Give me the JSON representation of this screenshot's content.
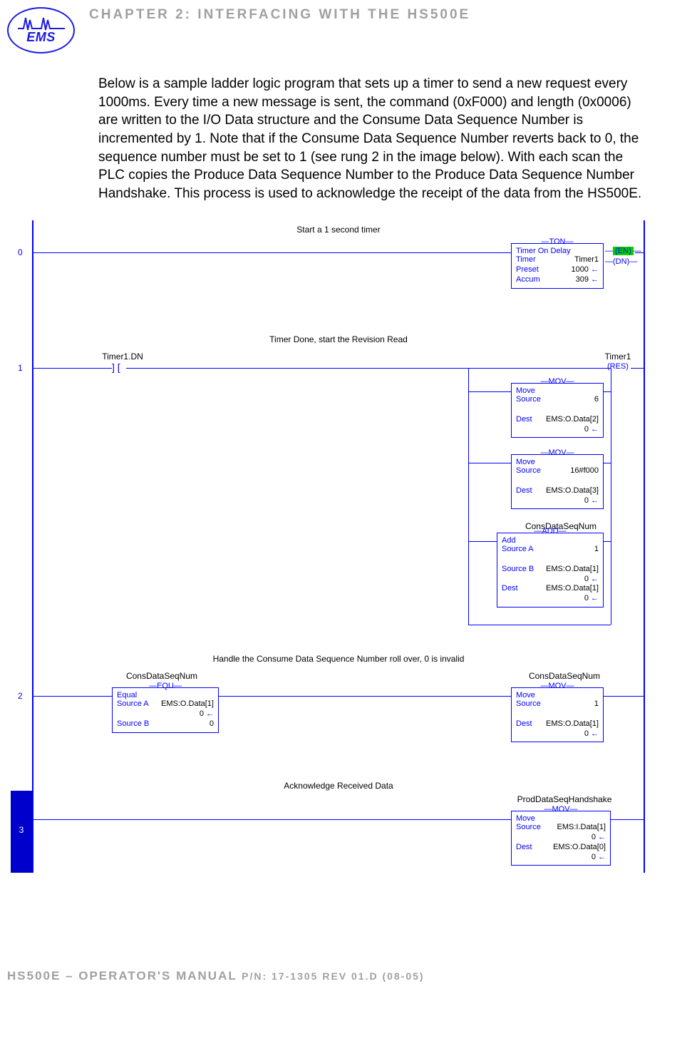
{
  "header": {
    "logo_text": "EMS",
    "chapter": "CHAPTER 2: INTERFACING WITH THE HS500E"
  },
  "body_paragraph": "Below is a sample ladder logic program that sets up a timer to send a new request every 1000ms. Every time a new message is sent, the command (0xF000) and length (0x0006) are written to the I/O Data structure and the Consume Data Sequence Number is incremented by 1. Note that if the Consume Data Sequence Number reverts back to 0, the sequence number must be set to 1 (see rung 2 in the image below). With each scan the PLC copies the Produce Data Sequence Number to the Produce Data Sequence Number Handshake. This process is used to acknowledge the receipt of the data from the HS500E.",
  "ladder": {
    "rung0": {
      "num": "0",
      "comment": "Start a 1 second timer",
      "ton": {
        "type": "TON",
        "title": "Timer On Delay",
        "rows": [
          {
            "l": "Timer",
            "r": "Timer1"
          },
          {
            "l": "Preset",
            "r": "1000"
          },
          {
            "l": "Accum",
            "r": "309"
          }
        ],
        "en": "(EN)",
        "dn": "(DN)"
      }
    },
    "rung1": {
      "num": "1",
      "comment": "Timer Done, start the Revision Read",
      "contact_tag": "Timer1.DN",
      "res_tag": "Timer1",
      "res": "(RES)",
      "mov1": {
        "type": "MOV",
        "title": "Move",
        "rows": [
          {
            "l": "Source",
            "r": "6"
          },
          {
            "l": "",
            "r": ""
          },
          {
            "l": "Dest",
            "r": "EMS:O.Data[2]"
          },
          {
            "l": "",
            "r": "0"
          }
        ]
      },
      "mov2": {
        "type": "MOV",
        "title": "Move",
        "rows": [
          {
            "l": "Source",
            "r": "16#f000"
          },
          {
            "l": "",
            "r": ""
          },
          {
            "l": "Dest",
            "r": "EMS:O.Data[3]"
          },
          {
            "l": "",
            "r": "0"
          }
        ]
      },
      "add": {
        "tag_above": "ConsDataSeqNum",
        "type": "ADD",
        "title": "Add",
        "rows": [
          {
            "l": "Source A",
            "r": "1"
          },
          {
            "l": "",
            "r": ""
          },
          {
            "l": "Source B",
            "r": "EMS:O.Data[1]"
          },
          {
            "l": "",
            "r": "0"
          },
          {
            "l": "Dest",
            "r": "EMS:O.Data[1]"
          },
          {
            "l": "",
            "r": "0"
          }
        ]
      }
    },
    "rung2": {
      "num": "2",
      "comment": "Handle the Consume Data Sequence Number roll over, 0 is invalid",
      "equ": {
        "tag_above": "ConsDataSeqNum",
        "type": "EQU",
        "title": "Equal",
        "rows": [
          {
            "l": "Source A",
            "r": "EMS:O.Data[1]"
          },
          {
            "l": "",
            "r": "0"
          },
          {
            "l": "Source B",
            "r": "0"
          }
        ]
      },
      "mov": {
        "tag_above": "ConsDataSeqNum",
        "type": "MOV",
        "title": "Move",
        "rows": [
          {
            "l": "Source",
            "r": "1"
          },
          {
            "l": "",
            "r": ""
          },
          {
            "l": "Dest",
            "r": "EMS:O.Data[1]"
          },
          {
            "l": "",
            "r": "0"
          }
        ]
      }
    },
    "rung3": {
      "num": "3",
      "comment": "Acknowledge Received Data",
      "mov": {
        "tag_above": "ProdDataSeqHandshake",
        "type": "MOV",
        "title": "Move",
        "rows": [
          {
            "l": "Source",
            "r": "EMS:I.Data[1]"
          },
          {
            "l": "",
            "r": "0"
          },
          {
            "l": "Dest",
            "r": "EMS:O.Data[0]"
          },
          {
            "l": "",
            "r": "0"
          }
        ]
      }
    }
  },
  "footer": {
    "main": "HS500E – OPERATOR'S MANUAL ",
    "pn": "P/N: 17-1305 REV 01.D (08-05)"
  }
}
